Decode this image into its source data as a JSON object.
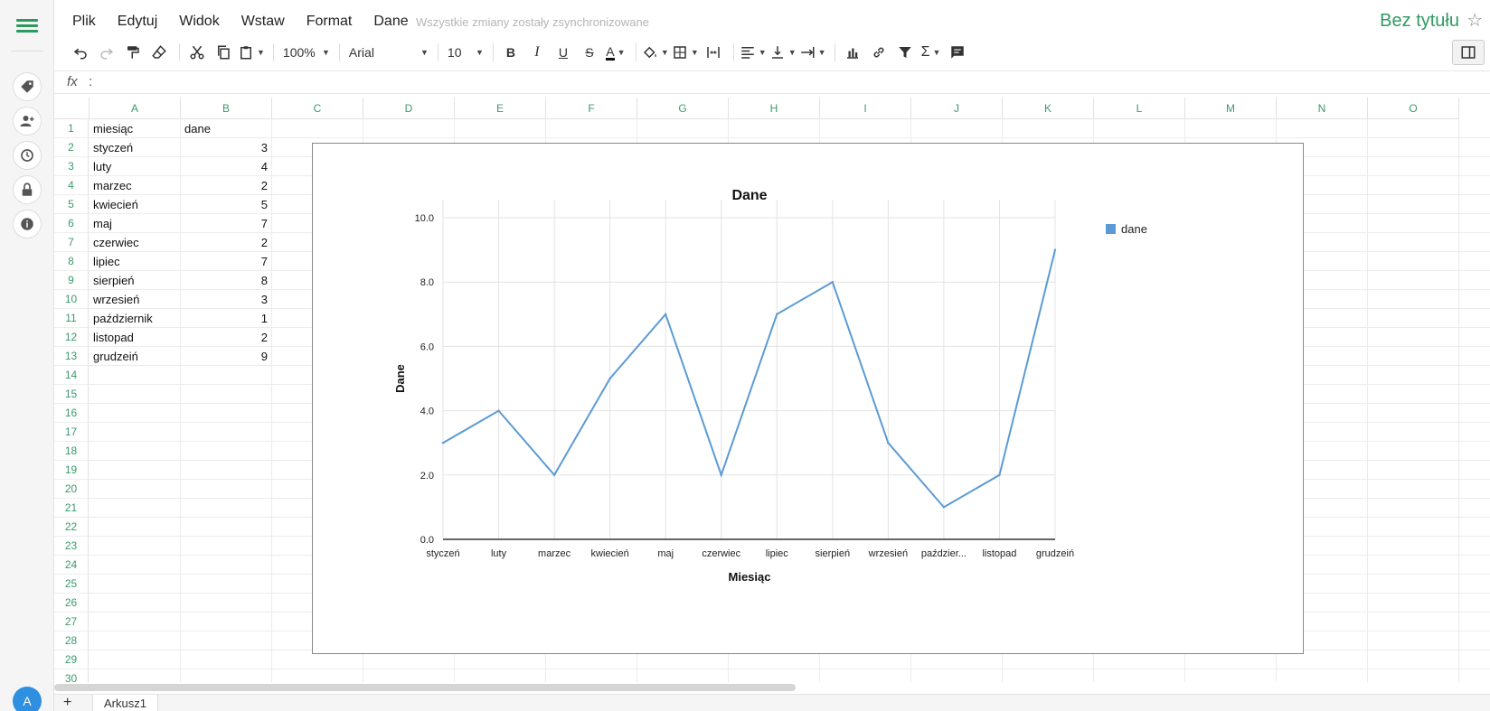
{
  "menubar": {
    "items": [
      "Plik",
      "Edytuj",
      "Widok",
      "Wstaw",
      "Format",
      "Dane"
    ],
    "sync_status": "Wszystkie zmiany zostały zsynchronizowane",
    "doc_title": "Bez tytułu"
  },
  "toolbar": {
    "zoom": "100%",
    "font": "Arial",
    "font_size": "10",
    "bold": "B",
    "italic": "I",
    "underline": "U",
    "strike": "S",
    "textcolor": "A",
    "sum": "Σ"
  },
  "formula_bar": {
    "fx": "fx",
    "colon": ":"
  },
  "grid": {
    "columns": [
      "A",
      "B",
      "C",
      "D",
      "E",
      "F",
      "G",
      "H",
      "I",
      "J",
      "K",
      "L",
      "M",
      "N",
      "O"
    ],
    "rows": [
      "1",
      "2",
      "3",
      "4",
      "5",
      "6",
      "7",
      "8",
      "9",
      "10",
      "11",
      "12",
      "13",
      "14",
      "15",
      "16",
      "17",
      "18",
      "19",
      "20",
      "21",
      "22",
      "23",
      "24",
      "25",
      "26",
      "27",
      "28",
      "29",
      "30"
    ],
    "cells": [
      [
        "miesiąc",
        "dane"
      ],
      [
        "styczeń",
        "3"
      ],
      [
        "luty",
        "4"
      ],
      [
        "marzec",
        "2"
      ],
      [
        "kwiecień",
        "5"
      ],
      [
        "maj",
        "7"
      ],
      [
        "czerwiec",
        "2"
      ],
      [
        "lipiec",
        "7"
      ],
      [
        "sierpień",
        "8"
      ],
      [
        "wrzesień",
        "3"
      ],
      [
        "październik",
        "1"
      ],
      [
        "listopad",
        "2"
      ],
      [
        "grudzeiń",
        "9"
      ]
    ]
  },
  "chart_data": {
    "type": "line",
    "title": "Dane",
    "xlabel": "Miesiąc",
    "ylabel": "Dane",
    "categories": [
      "styczeń",
      "luty",
      "marzec",
      "kwiecień",
      "maj",
      "czerwiec",
      "lipiec",
      "sierpień",
      "wrzesień",
      "paździer...",
      "listopad",
      "grudzeiń"
    ],
    "series": [
      {
        "name": "dane",
        "values": [
          3,
          4,
          2,
          5,
          7,
          2,
          7,
          8,
          3,
          1,
          2,
          9
        ]
      }
    ],
    "ylim": [
      0,
      10
    ],
    "yticks": [
      "0.0",
      "2.0",
      "4.0",
      "6.0",
      "8.0",
      "10.0"
    ],
    "ytick_values": [
      0,
      2,
      4,
      6,
      8,
      10
    ],
    "grid": true,
    "legend": "top-right",
    "line_color": "#5b9bd5"
  },
  "sheets": {
    "add": "+",
    "active": "Arkusz1"
  },
  "user": {
    "initial": "A"
  }
}
